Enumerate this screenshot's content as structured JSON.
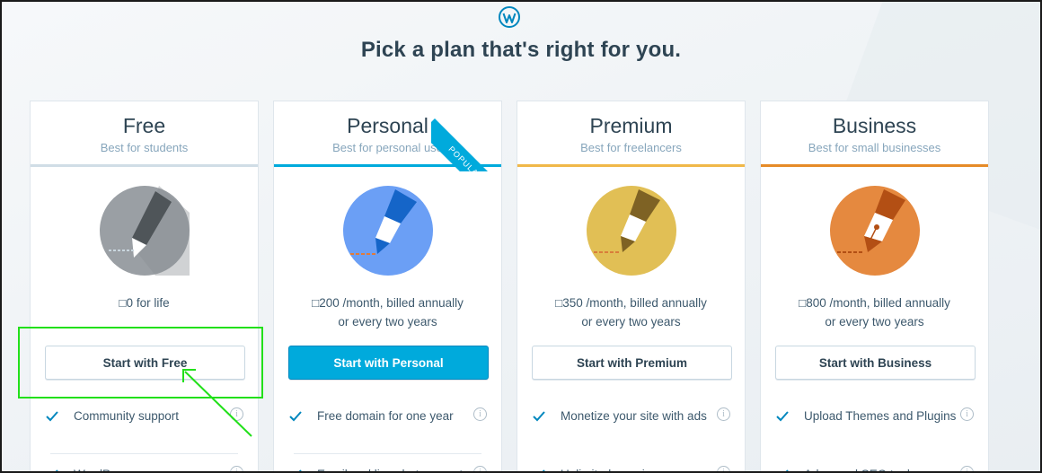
{
  "page": {
    "title": "Pick a plan that's right for you."
  },
  "ribbon": {
    "label": "POPULAR"
  },
  "plans": [
    {
      "name": "Free",
      "subtitle": "Best for students",
      "price_line1": "□0 for life",
      "price_line2": "",
      "button": "Start with Free",
      "feature1": "Community support",
      "feature2": "WordPress.com",
      "icon": "pencil-icon",
      "color": "#9a9fa4"
    },
    {
      "name": "Personal",
      "subtitle": "Best for personal use",
      "price_line1": "□200 /month, billed annually",
      "price_line2": "or every two years",
      "button": "Start with Personal",
      "feature1": "Free domain for one year",
      "feature2": "Email and live chat support",
      "icon": "pencil-icon",
      "color": "#6b9ff5"
    },
    {
      "name": "Premium",
      "subtitle": "Best for freelancers",
      "price_line1": "□350 /month, billed annually",
      "price_line2": "or every two years",
      "button": "Start with Premium",
      "feature1": "Monetize your site with ads",
      "feature2": "Unlimited premium",
      "icon": "brush-icon",
      "color": "#e1bf55"
    },
    {
      "name": "Business",
      "subtitle": "Best for small businesses",
      "price_line1": "□800 /month, billed annually",
      "price_line2": "or every two years",
      "button": "Start with Business",
      "feature1": "Upload Themes and Plugins",
      "feature2": "Advanced SEO tools",
      "icon": "fountain-pen-icon",
      "color": "#e5893f"
    }
  ],
  "accents": {
    "primary": "#00aadc",
    "annotation": "#22e01a"
  }
}
